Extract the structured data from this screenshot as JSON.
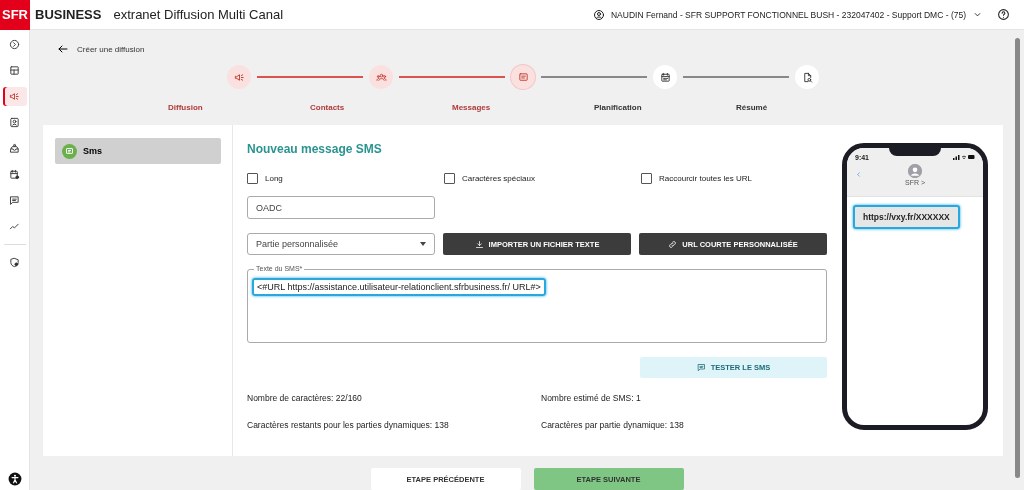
{
  "header": {
    "logo": "SFR",
    "brand": "BUSINESS",
    "title": "extranet Diffusion Multi Canal",
    "user": "NAUDIN Fernand - SFR SUPPORT FONCTIONNEL BUSH - 232047402 - Support DMC - (75)"
  },
  "nav": [
    {
      "selected": false
    },
    {
      "selected": false
    },
    {
      "selected": true
    },
    {
      "selected": false
    },
    {
      "selected": false
    },
    {
      "selected": false
    },
    {
      "selected": false
    },
    {
      "selected": false
    },
    {
      "selected": false
    }
  ],
  "breadcrumb": "Créer une diffusion",
  "steps": [
    {
      "label": "Diffusion",
      "completed": true,
      "selected": false
    },
    {
      "label": "Contacts",
      "completed": true,
      "selected": false
    },
    {
      "label": "Messages",
      "completed": false,
      "selected": true
    },
    {
      "label": "Planification",
      "completed": false,
      "selected": false
    },
    {
      "label": "Résumé",
      "completed": false,
      "selected": false
    }
  ],
  "channels": [
    {
      "label": "Sms",
      "selected": true
    }
  ],
  "form": {
    "title": "Nouveau message SMS",
    "options": [
      {
        "label": "Long",
        "checked": false
      },
      {
        "label": "Caractères spéciaux",
        "checked": false
      },
      {
        "label": "Raccourcir toutes les URL",
        "checked": false
      }
    ],
    "oadc": {
      "placeholder": "OADC"
    },
    "select": {
      "value": "Partie personnalisée"
    },
    "buttons": [
      {
        "label": "IMPORTER UN FICHIER TEXTE",
        "kind": "import"
      },
      {
        "label": "URL COURTE PERSONNALISÉE",
        "kind": "link"
      }
    ],
    "sms_text": {
      "label": "Texte du SMS*",
      "value": "<#URL https://assistance.utilisateur-relationclient.sfrbusiness.fr/ URL#>",
      "highlighted": true
    },
    "test_button": "TESTER LE SMS",
    "stats": [
      "Nombre de caractères: 22/160",
      "Nombre estimé de SMS: 1",
      "Caractères restants pour les parties dynamiques: 138",
      "Caractères par partie dynamique: 138"
    ]
  },
  "preview": {
    "time": "9:41",
    "contact": "SFR >",
    "message": "https://vxy.fr/XXXXXX",
    "highlighted": true
  },
  "footer": {
    "previous": "ETAPE PRÉCÉDENTE",
    "next": "ETAPE SUIVANTE"
  }
}
